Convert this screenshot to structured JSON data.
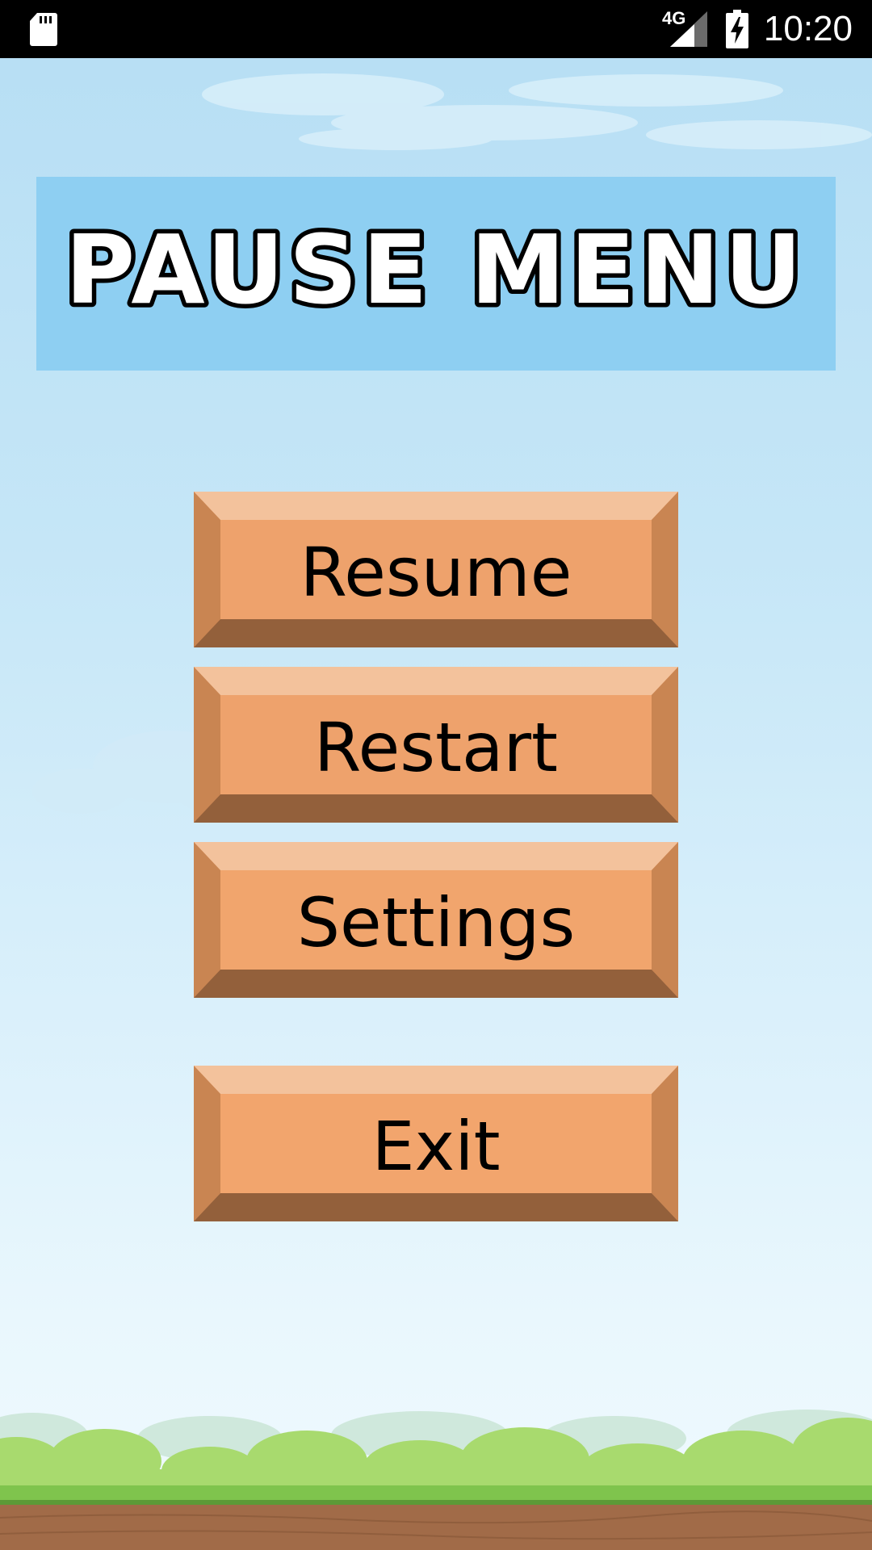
{
  "status_bar": {
    "network": "4G",
    "time": "10:20",
    "icons": [
      "sd-card-icon",
      "signal-icon",
      "battery-charging-icon"
    ]
  },
  "title": "PAUSE MENU",
  "buttons": {
    "resume": "Resume",
    "restart": "Restart",
    "settings": "Settings",
    "exit": "Exit"
  },
  "colors": {
    "banner": "#8ecff2",
    "button_face": "#eea26c",
    "button_top": "#f3c29c",
    "button_side": "#c98552",
    "button_bottom": "#93603b"
  }
}
